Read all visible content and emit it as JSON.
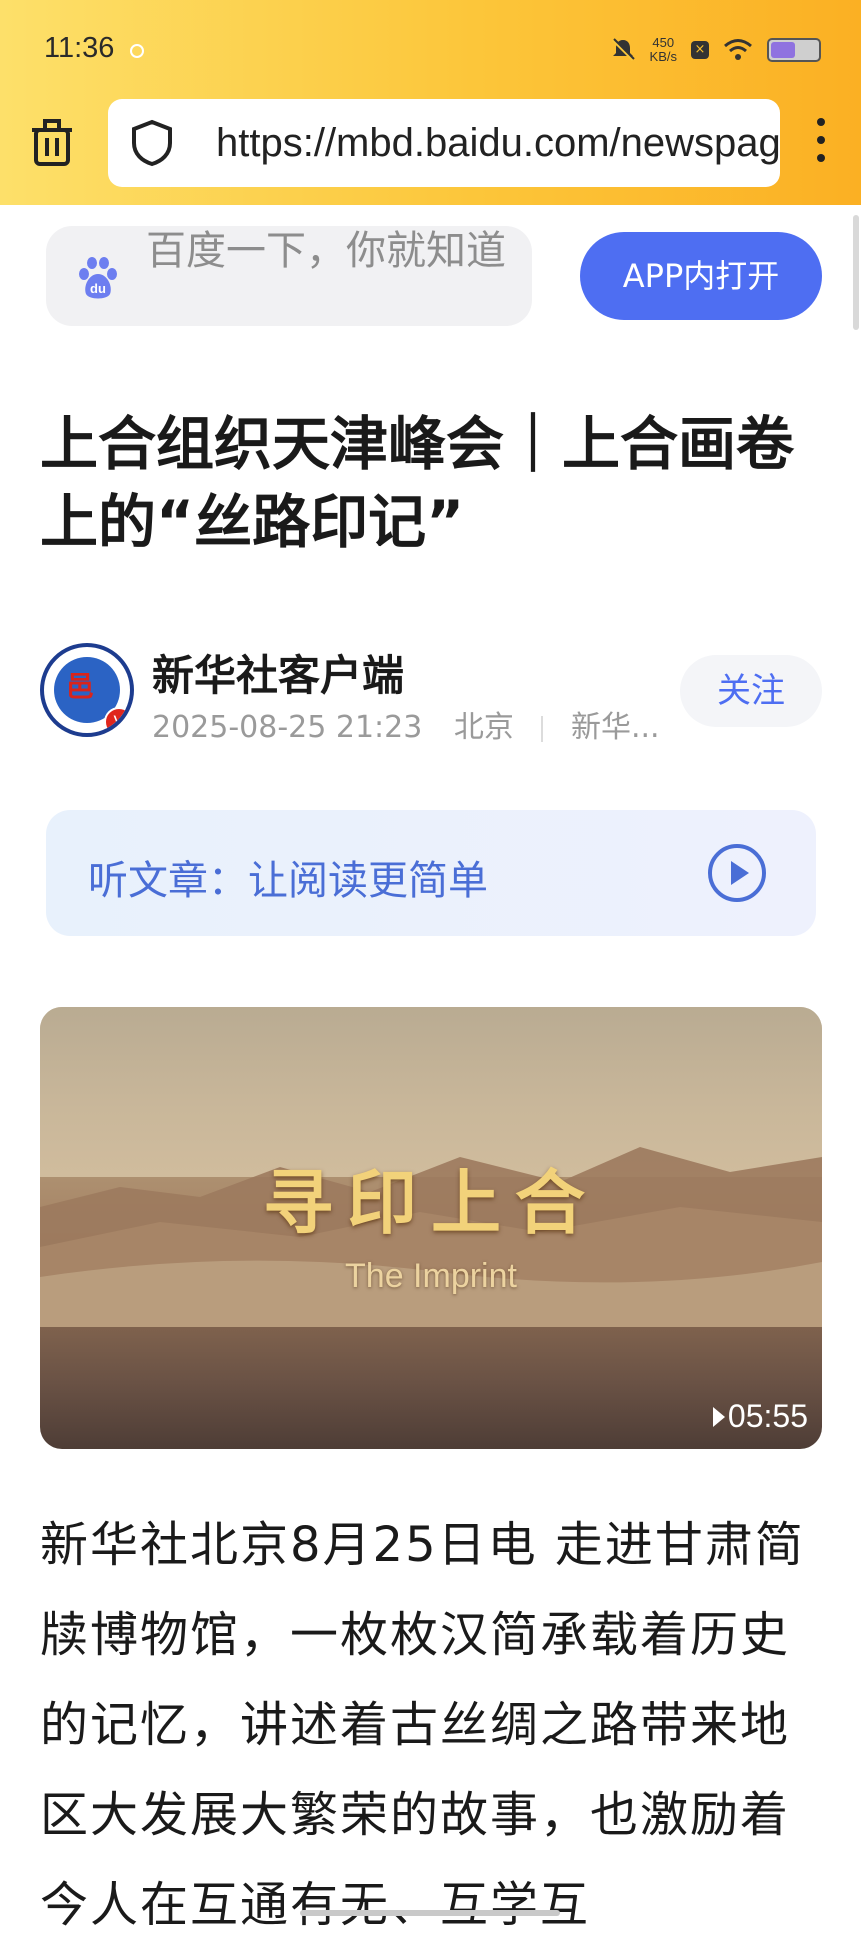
{
  "status_bar": {
    "time": "11:36",
    "net_speed_value": "450",
    "net_speed_unit": "KB/s"
  },
  "browser": {
    "url": "https://mbd.baidu.com/newspage",
    "icons": [
      "trash-icon",
      "shield-icon",
      "more-vertical-icon"
    ]
  },
  "baidu_bar": {
    "search_placeholder": "百度一下，你就知道",
    "open_app_label": "APP内打开"
  },
  "article": {
    "title": "上合组织天津峰会｜上合画卷上的“丝路印记”",
    "author": "新华社客户端",
    "date": "2025-08-25 21:23",
    "location": "北京",
    "source": "新华...",
    "follow_label": "关注",
    "listen_label": "听文章：让阅读更简单",
    "video": {
      "title_cn": "寻印上合",
      "title_en": "The Imprint",
      "duration": "05:55"
    },
    "body": "新华社北京8月25日电 走进甘肃简牍博物馆，一枚枚汉简承载着历史的记忆，讲述着古丝绸之路带来地区大发展大繁荣的故事，也激励着今人在互通有无、互学互"
  },
  "colors": {
    "accent_blue": "#4e6ef2",
    "toolbar_yellow": "#fcc63a",
    "listen_text": "#4a6ed6"
  }
}
